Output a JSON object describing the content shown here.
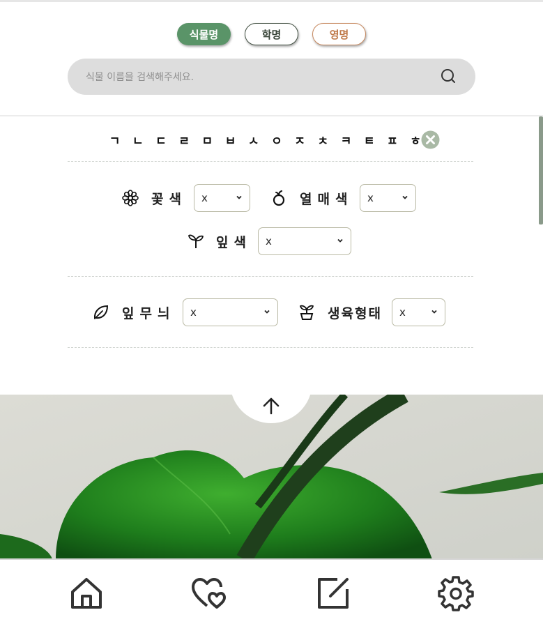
{
  "search_tabs": [
    {
      "label": "식물명",
      "active": true,
      "color": "#5a9468"
    },
    {
      "label": "학명",
      "active": false,
      "color": "#445244"
    },
    {
      "label": "영명",
      "active": false,
      "color": "#c07a4a"
    }
  ],
  "search": {
    "placeholder": "식물 이름을 검색해주세요.",
    "icon": "search-icon"
  },
  "consonants": [
    "ㄱ",
    "ㄴ",
    "ㄷ",
    "ㄹ",
    "ㅁ",
    "ㅂ",
    "ㅅ",
    "ㅇ",
    "ㅈ",
    "ㅊ",
    "ㅋ",
    "ㅌ",
    "ㅍ",
    "ㅎ"
  ],
  "consonant_clear_icon": "close-circle-icon",
  "filters": {
    "flower_color": {
      "label": "꽃색",
      "icon": "flower-icon",
      "value": "x"
    },
    "fruit_color": {
      "label": "열매색",
      "icon": "fruit-icon",
      "value": "x"
    },
    "leaf_color": {
      "label": "잎색",
      "icon": "sprout-icon",
      "value": "x"
    },
    "leaf_pattern": {
      "label": "잎무늬",
      "icon": "leaf-icon",
      "value": "x"
    },
    "growth_form": {
      "label": "생육형태",
      "icon": "seedling-pot-icon",
      "value": "x"
    }
  },
  "scroll_hint_icon": "mouse-icon",
  "scroll_up_icon": "arrow-up-icon",
  "bottom_nav": [
    {
      "name": "home",
      "icon": "home-icon"
    },
    {
      "name": "favorites",
      "icon": "hearts-icon"
    },
    {
      "name": "write",
      "icon": "edit-icon"
    },
    {
      "name": "settings",
      "icon": "gear-icon"
    }
  ],
  "colors": {
    "accent": "#5a9468",
    "english_tab": "#c07a4a",
    "search_bg": "#dddddd"
  }
}
